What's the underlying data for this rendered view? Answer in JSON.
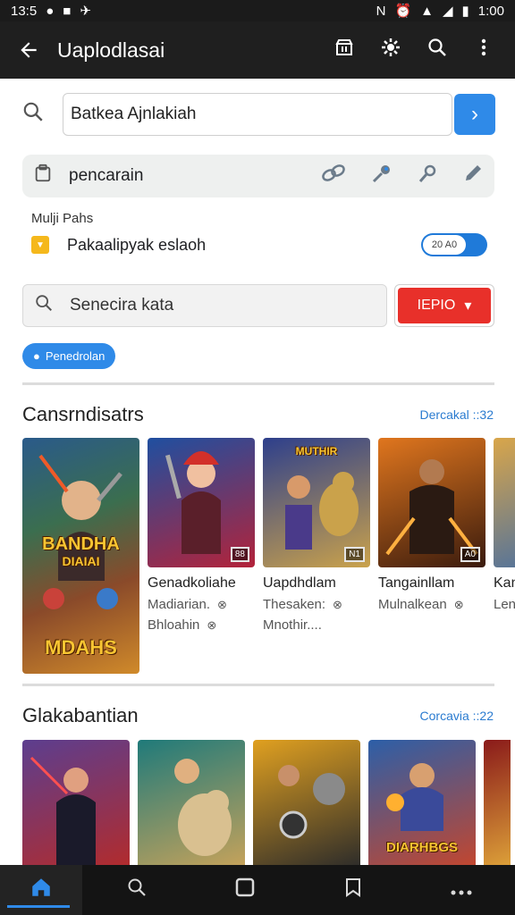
{
  "status_bar": {
    "time_left": "13:5",
    "indicators_left": [
      "●",
      "■",
      "✈"
    ],
    "indicators_right": [
      "N",
      "⏰",
      "▲",
      "◢",
      "▮"
    ],
    "time_right": "1:00"
  },
  "app_bar": {
    "title": "Uaplodlasai",
    "icons": [
      "back-arrow-icon",
      "store-icon",
      "gear-icon",
      "search-icon",
      "more-vert-icon"
    ]
  },
  "search": {
    "value": "Batkea Ajnlakiah",
    "go_glyph": "›"
  },
  "pencarian": {
    "label": "pencarain",
    "tool_icons": [
      "link-icon",
      "pin-icon",
      "key-icon",
      "pen-icon"
    ]
  },
  "multi": {
    "label": "Mulji Pahs",
    "toggle_text": "Pakaalipyak eslaoh",
    "toggle_value": "20 A0",
    "toggle_on": true
  },
  "search2": {
    "value": "Senecira kata",
    "dropdown_label": "IEPIO",
    "dropdown_caret": "▾"
  },
  "chip": {
    "label": "Penedrolan"
  },
  "section1": {
    "title": "Cansrndisatrs",
    "link": "Dercakal ::32",
    "big_card": {
      "art_title": "BANDHA",
      "art_sub": "DIAIAI",
      "art_bottom": "MDAHS"
    },
    "cards": [
      {
        "name": "Genadkoliahe",
        "line1": "Madiarian.",
        "line2": "Bhloahin",
        "tag": "88",
        "art": "",
        "colors": [
          "#1f4fa0",
          "#b3233a"
        ]
      },
      {
        "name": "Uapdhdlam",
        "line1": "Thesaken:",
        "line2": "Mnothir....",
        "tag": "N1",
        "art": "MUTHIR",
        "colors": [
          "#2d3f8c",
          "#caa24b"
        ]
      },
      {
        "name": "Tangainllam",
        "line1": "Mulnalkean",
        "line2": "",
        "tag": "A0",
        "art": "",
        "colors": [
          "#e0761e",
          "#3a1b0d"
        ]
      },
      {
        "name": "Kan",
        "line1": "Len",
        "line2": "",
        "tag": "",
        "art": "",
        "colors": [
          "#d9a64a",
          "#3d6aa8"
        ]
      }
    ]
  },
  "section2": {
    "title": "Glakabantian",
    "link": "Corcavia ::22",
    "cards": [
      {
        "art": "",
        "colors": [
          "#5c3e8f",
          "#b32b2b"
        ]
      },
      {
        "art": "",
        "colors": [
          "#1f7a7a",
          "#c8a35a"
        ]
      },
      {
        "art": "",
        "colors": [
          "#e0a020",
          "#2a2a2a"
        ]
      },
      {
        "art": "DIARHBGS",
        "colors": [
          "#2c5fa8",
          "#c5462d"
        ]
      },
      {
        "art": "",
        "colors": [
          "#8a1a1a",
          "#f0c040"
        ]
      }
    ]
  },
  "bottom_nav": {
    "items": [
      "home-icon",
      "search-icon",
      "square-icon",
      "bookmark-icon",
      "more-horiz-icon"
    ]
  }
}
